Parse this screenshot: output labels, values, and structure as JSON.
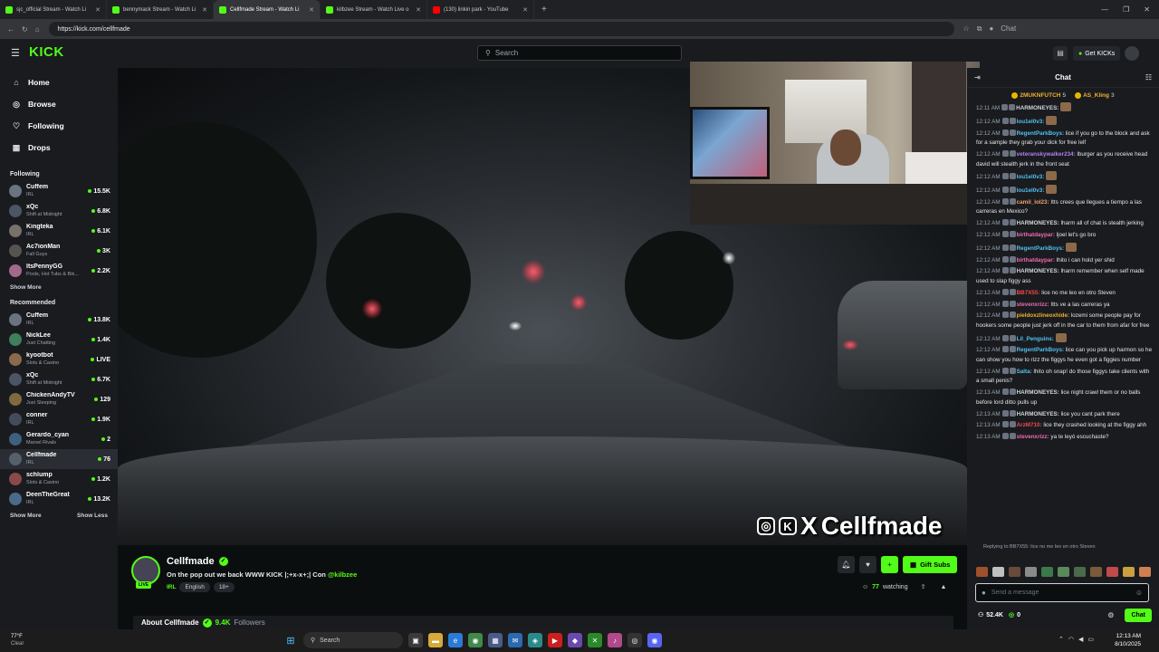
{
  "browser": {
    "tabs": [
      {
        "title": "sjc_official Stream - Watch Li",
        "active": false,
        "favicon": "kick"
      },
      {
        "title": "bennymack Stream - Watch Li",
        "active": false,
        "favicon": "kick"
      },
      {
        "title": "Cellfmade Stream - Watch Li",
        "active": true,
        "favicon": "kick"
      },
      {
        "title": "kilbzee Stream - Watch Live o",
        "active": false,
        "favicon": "kick"
      },
      {
        "title": "(130) linkin park - YouTube",
        "active": false,
        "favicon": "youtube"
      }
    ],
    "url": "https://kick.com/cellfmade",
    "profile_label": "Chat"
  },
  "topnav": {
    "logo": "KICK",
    "search_placeholder": "Search",
    "get_kicks_label": "Get KICKs"
  },
  "sidebar": {
    "nav": [
      {
        "label": "Home",
        "icon": "home-icon"
      },
      {
        "label": "Browse",
        "icon": "compass-icon"
      },
      {
        "label": "Following",
        "icon": "heart-icon"
      },
      {
        "label": "Drops",
        "icon": "gift-icon"
      }
    ],
    "following_title": "Following",
    "following": [
      {
        "name": "Cuffem",
        "category": "IRL",
        "viewers": "15.5K",
        "color": "#6b7280"
      },
      {
        "name": "xQc",
        "category": "Shift at Midnight",
        "viewers": "6.8K",
        "color": "#4b5563"
      },
      {
        "name": "Kingteka",
        "category": "IRL",
        "viewers": "6.1K",
        "color": "#78716c"
      },
      {
        "name": "Ac7ionMan",
        "category": "Fall Guys",
        "viewers": "3K",
        "color": "#57534e"
      },
      {
        "name": "ItsPennyGG",
        "category": "Pools, Hot Tubs & Bik...",
        "viewers": "2.2K",
        "color": "#a16a8a"
      }
    ],
    "show_more": "Show More",
    "recommended_title": "Recommended",
    "recommended": [
      {
        "name": "Cuffem",
        "category": "IRL",
        "viewers": "13.8K",
        "color": "#6b7280"
      },
      {
        "name": "NickLee",
        "category": "Just Chatting",
        "viewers": "1.4K",
        "color": "#3f7f5a"
      },
      {
        "name": "kyootbot",
        "category": "Slots & Casino",
        "viewers": "LIVE",
        "color": "#8a6a4a"
      },
      {
        "name": "xQc",
        "category": "Shift at Midnight",
        "viewers": "6.7K",
        "color": "#4b5563"
      },
      {
        "name": "ChickenAndyTV",
        "category": "Just Sleeping",
        "viewers": "129",
        "color": "#7f6a3f"
      },
      {
        "name": "conner",
        "category": "IRL",
        "viewers": "1.9K",
        "color": "#444b5a"
      },
      {
        "name": "Gerardo_cyan",
        "category": "Marvel Rivals",
        "viewers": "2",
        "color": "#3f5f7f"
      },
      {
        "name": "Cellfmade",
        "category": "IRL",
        "viewers": "76",
        "color": "#55606a",
        "active": true
      },
      {
        "name": "schlump",
        "category": "Slots & Casino",
        "viewers": "1.2K",
        "color": "#8a4a4a"
      },
      {
        "name": "DeenTheGreat",
        "category": "IRL",
        "viewers": "13.2K",
        "color": "#4a6a8a"
      }
    ],
    "show_more_2": "Show More",
    "show_less": "Show Less"
  },
  "stream": {
    "watermark_text": "Cellfmade",
    "channel_name": "Cellfmade",
    "title_text": "On the pop out we back WWW KICK |;+x-x+;| Con ",
    "title_mention": "@kilbzee",
    "category": "IRL",
    "tags": [
      "English",
      "18+"
    ],
    "watching_count": "77",
    "watching_label": "watching",
    "gift_subs_label": "Gift Subs",
    "live_label": "LIVE",
    "about_label": "About Cellfmade",
    "followers_count": "9.4K",
    "followers_label": "Followers"
  },
  "chat": {
    "title": "Chat",
    "pinned": [
      {
        "name": "2MUKNFUTCH",
        "count": "5"
      },
      {
        "name": "AS_Kling",
        "count": "3"
      }
    ],
    "messages": [
      {
        "time": "12:11 AM",
        "user": "HARMONEYES:",
        "color": "#d1d5db",
        "text": "",
        "emote": true
      },
      {
        "time": "12:12 AM",
        "user": "lou1el0v3:",
        "color": "#53c0f0",
        "text": "",
        "emote": true
      },
      {
        "time": "12:12 AM",
        "user": "RegentParkBoys:",
        "color": "#53c0f0",
        "text": "lice if you go to the block and ask for a sample they grab your dick for free lelf"
      },
      {
        "time": "12:12 AM",
        "user": "veteranskywalker234:",
        "color": "#b77cf0",
        "text": "lburger as you receive head david will stealth jerk in the front seat"
      },
      {
        "time": "12:12 AM",
        "user": "lou1el0v3:",
        "color": "#53c0f0",
        "text": "",
        "emote": true
      },
      {
        "time": "12:12 AM",
        "user": "lou1el0v3:",
        "color": "#53c0f0",
        "text": "",
        "emote": true
      },
      {
        "time": "12:12 AM",
        "user": "camil_lol23:",
        "color": "#f0a070",
        "text": "Itts crees que llegues a tiempo a las carreras en Mexico?"
      },
      {
        "time": "12:12 AM",
        "user": "HARMONEYES:",
        "color": "#d1d5db",
        "text": "lharm all of chat is stealth jerking"
      },
      {
        "time": "12:12 AM",
        "user": "birthatdaypar:",
        "color": "#f06ab0",
        "text": "ljoel let's go bro"
      },
      {
        "time": "12:12 AM",
        "user": "RegentParkBoys:",
        "color": "#53c0f0",
        "text": "",
        "emote": true
      },
      {
        "time": "12:12 AM",
        "user": "birthatdaypar:",
        "color": "#f06ab0",
        "text": "lhito i can hold yer shid"
      },
      {
        "time": "12:12 AM",
        "user": "HARMONEYES:",
        "color": "#d1d5db",
        "text": "lharm remember when self made used to slap figgy ass"
      },
      {
        "time": "12:12 AM",
        "user": "BB7X55:",
        "color": "#f04a4a",
        "text": "lice no me leo en otro Steven"
      },
      {
        "time": "12:12 AM",
        "user": "stevenxrizz:",
        "color": "#f06ab0",
        "text": "Itts ve a las carreras ya"
      },
      {
        "time": "12:12 AM",
        "user": "pieldoxzlineoxhide:",
        "color": "#f0b030",
        "text": "lozemi some people pay for hookers some people just jerk off in the car to them from afar for free"
      },
      {
        "time": "12:12 AM",
        "user": "Lil_Penguins:",
        "color": "#53c0f0",
        "text": "",
        "emote": true
      },
      {
        "time": "12:12 AM",
        "user": "RegentParkBoys:",
        "color": "#53c0f0",
        "text": "lice can you pick up harmon so he can show you how to rizz the figgys he even got a figgies number"
      },
      {
        "time": "12:12 AM",
        "user": "Salta:",
        "color": "#53c0f0",
        "text": "lhito oh snap! do those figgys take clients with a small penis?"
      },
      {
        "time": "12:13 AM",
        "user": "HARMONEYES:",
        "color": "#d1d5db",
        "text": "lice night crawl them or no balls before lord ditto pulls up"
      },
      {
        "time": "12:13 AM",
        "user": "HARMONEYES:",
        "color": "#d1d5db",
        "text": "lice you cant park there"
      },
      {
        "time": "12:13 AM",
        "user": "ArzM710:",
        "color": "#f04a4a",
        "text": "lice they crashed looking at the figgy ahh"
      },
      {
        "time": "12:13 AM",
        "user": "stevenxrizz:",
        "color": "#f06ab0",
        "text": "ya te leyó escuchaste?"
      }
    ],
    "reply_note": "Replying to BB7X55: lice no me leo en otro Steven",
    "input_placeholder": "Send a message",
    "points": "52.4K",
    "kicks": "0",
    "send_label": "Chat"
  },
  "taskbar": {
    "weather_temp": "77°F",
    "weather_desc": "Clear",
    "search_label": "Search",
    "time": "12:13 AM",
    "date": "8/10/2025"
  }
}
